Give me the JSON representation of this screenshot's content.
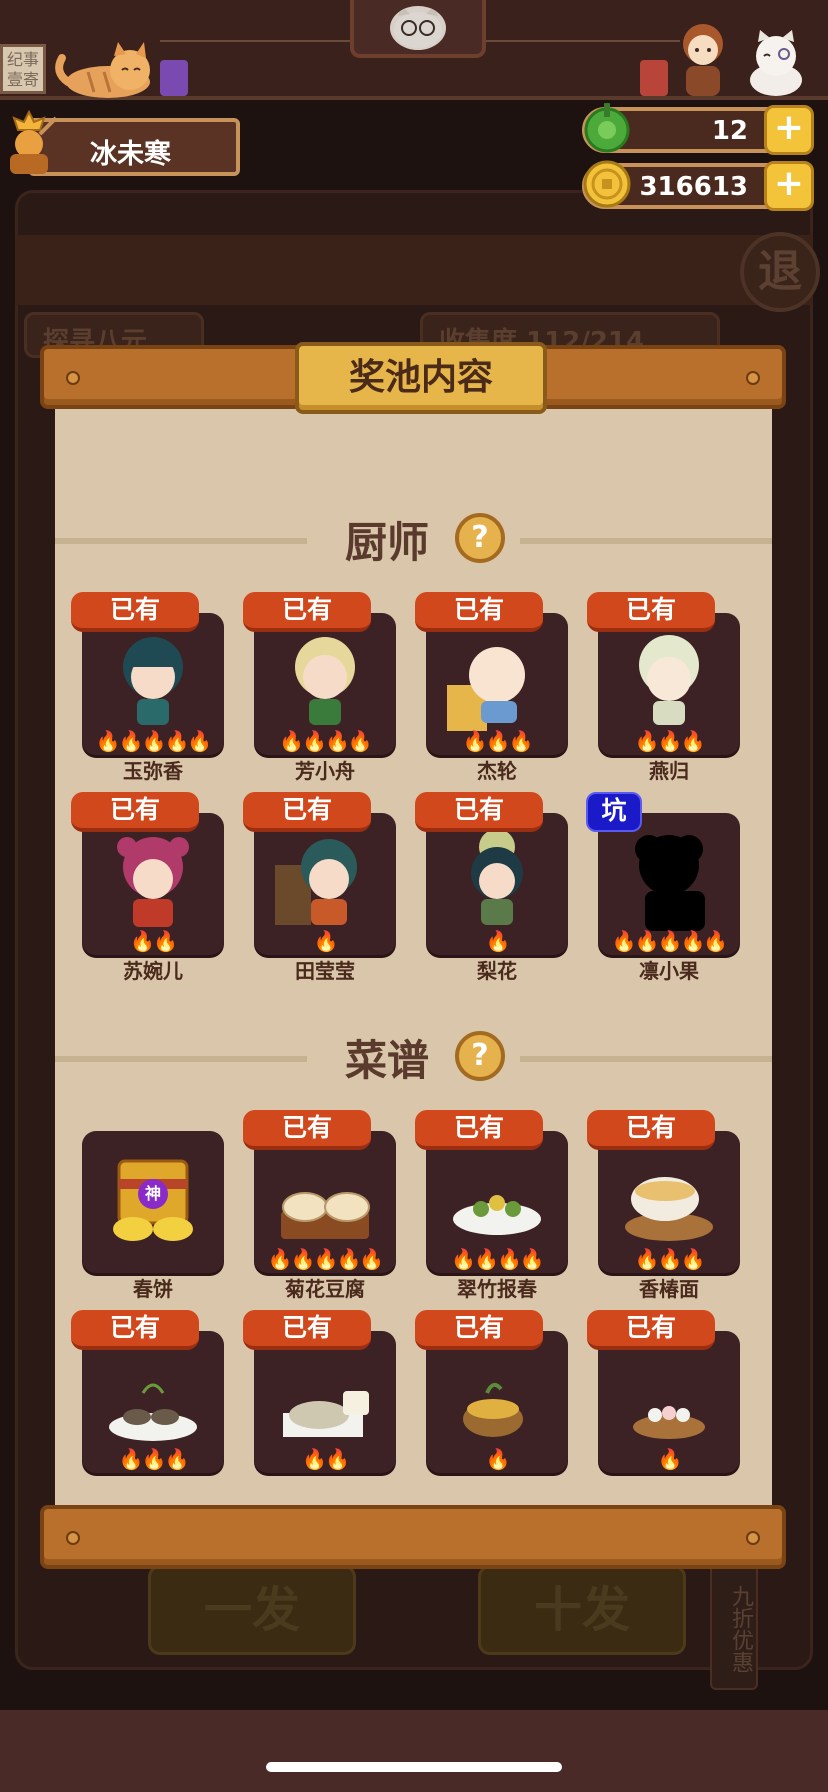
{
  "header": {
    "sign_left_text": "纪事\n壹寄",
    "player_name": "冰未寒",
    "currencies": [
      {
        "icon": "jade-icon",
        "value": "12"
      },
      {
        "icon": "coin-icon",
        "value": "316613"
      }
    ],
    "plus_label": "+"
  },
  "background": {
    "exit_label": "退",
    "tab_left": "探寻八元",
    "tab_right": "收集度 112/214",
    "btn_one": "一发",
    "btn_ten": "十发",
    "discount": "九折优惠"
  },
  "modal": {
    "title": "奖池内容",
    "help_label": "?",
    "sections": [
      {
        "title": "厨师",
        "items": [
          {
            "name": "玉弥香",
            "badge": "已有",
            "badge_type": "owned",
            "flames": 5
          },
          {
            "name": "芳小舟",
            "badge": "已有",
            "badge_type": "owned",
            "flames": 4
          },
          {
            "name": "杰轮",
            "badge": "已有",
            "badge_type": "owned",
            "flames": 3
          },
          {
            "name": "燕归",
            "badge": "已有",
            "badge_type": "owned",
            "flames": 3
          },
          {
            "name": "苏婉儿",
            "badge": "已有",
            "badge_type": "owned",
            "flames": 2
          },
          {
            "name": "田莹莹",
            "badge": "已有",
            "badge_type": "owned",
            "flames": 1
          },
          {
            "name": "梨花",
            "badge": "已有",
            "badge_type": "owned",
            "flames": 1
          },
          {
            "name": "凛小果",
            "badge": "坑",
            "badge_type": "pit",
            "flames": 5
          }
        ]
      },
      {
        "title": "菜谱",
        "items": [
          {
            "name": "春饼",
            "badge": "",
            "badge_type": "none",
            "flames": 0,
            "tag": "神"
          },
          {
            "name": "菊花豆腐",
            "badge": "已有",
            "badge_type": "owned",
            "flames": 5
          },
          {
            "name": "翠竹报春",
            "badge": "已有",
            "badge_type": "owned",
            "flames": 4
          },
          {
            "name": "香椿面",
            "badge": "已有",
            "badge_type": "owned",
            "flames": 3
          },
          {
            "name": "",
            "badge": "已有",
            "badge_type": "owned",
            "flames": 3
          },
          {
            "name": "",
            "badge": "已有",
            "badge_type": "owned",
            "flames": 2
          },
          {
            "name": "",
            "badge": "已有",
            "badge_type": "owned",
            "flames": 1
          },
          {
            "name": "",
            "badge": "已有",
            "badge_type": "owned",
            "flames": 1
          }
        ]
      }
    ]
  },
  "colors": {
    "badge_owned": "#d1481c",
    "badge_pit": "#1a1ac8",
    "panel": "#d9c6ab",
    "card": "#3c2224",
    "wood": "#b8702c",
    "gold": "#e7b64a"
  }
}
